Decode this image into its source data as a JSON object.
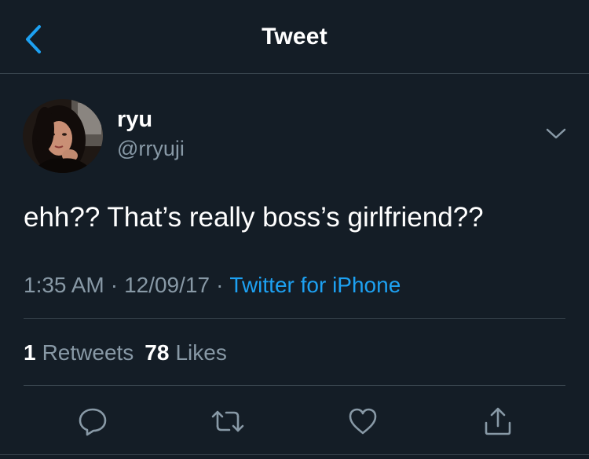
{
  "nav": {
    "title": "Tweet",
    "back_icon": "chevron-left-icon"
  },
  "tweet": {
    "author": {
      "display_name": "ryu",
      "handle": "@rryuji"
    },
    "text": "ehh?? That’s really boss’s girlfriend??",
    "time": "1:35 AM",
    "separator": "·",
    "date": "12/09/17",
    "source": "Twitter for iPhone"
  },
  "stats": {
    "retweets_count": "1",
    "retweets_label": "Retweets",
    "likes_count": "78",
    "likes_label": "Likes"
  },
  "actions": {
    "reply_icon": "reply-icon",
    "retweet_icon": "retweet-icon",
    "like_icon": "heart-icon",
    "share_icon": "share-icon"
  },
  "colors": {
    "background": "#141d26",
    "divider": "#38444d",
    "secondary_text": "#8899a6",
    "accent": "#1da1f2",
    "primary_text": "#ffffff"
  }
}
